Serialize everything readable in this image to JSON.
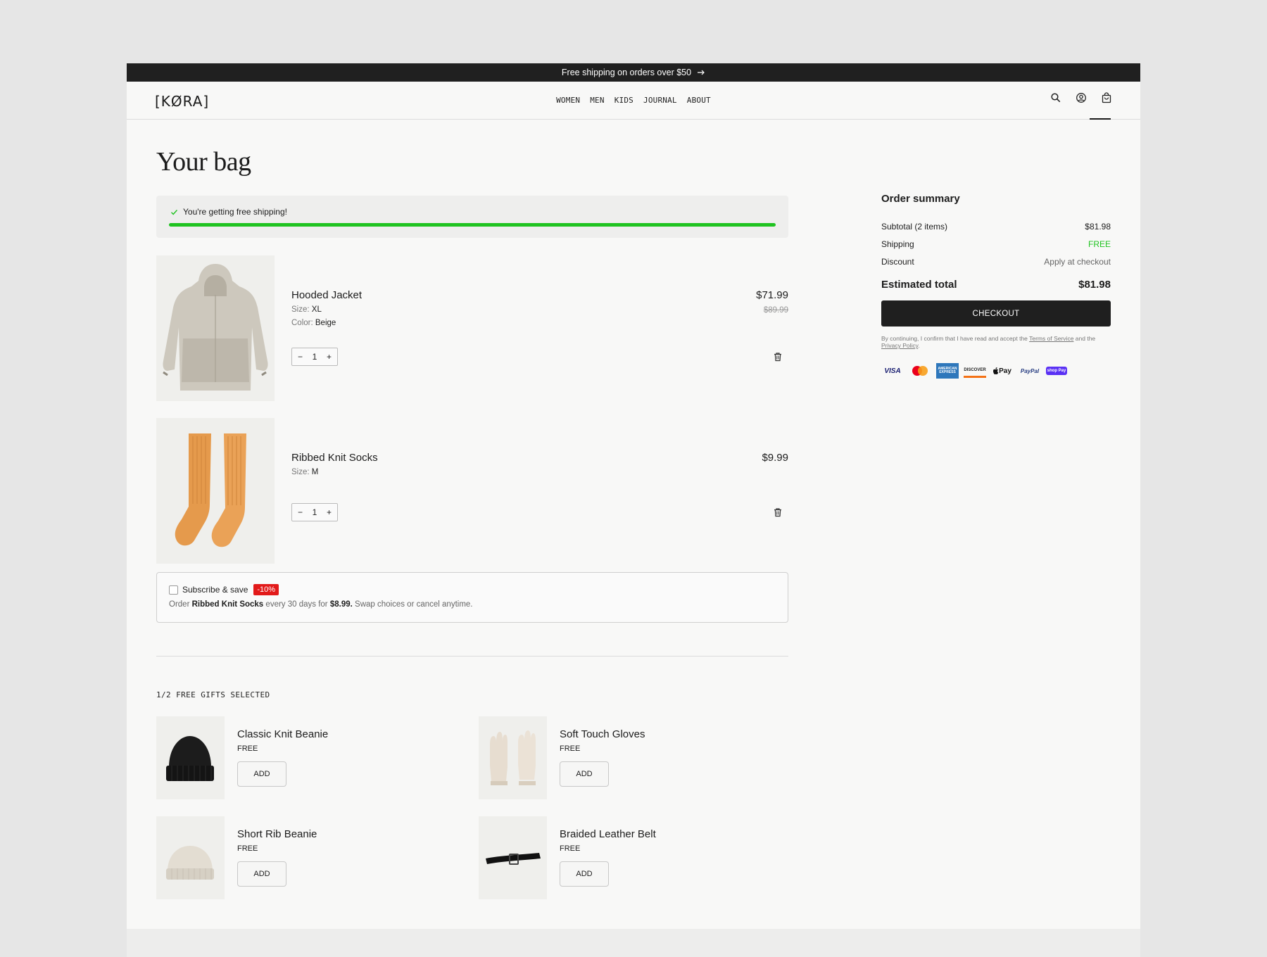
{
  "announcement": {
    "text": "Free shipping on orders over $50"
  },
  "header": {
    "logo": "[KØRA]",
    "nav": [
      "WOMEN",
      "MEN",
      "KIDS",
      "JOURNAL",
      "ABOUT"
    ]
  },
  "page": {
    "title": "Your bag"
  },
  "shipping": {
    "message": "You're getting free shipping!",
    "progress_percent": 100,
    "accent": "#1fc320"
  },
  "items": [
    {
      "name": "Hooded Jacket",
      "size_label": "Size:",
      "size": "XL",
      "color_label": "Color:",
      "color": "Beige",
      "price": "$71.99",
      "old_price": "$89.99",
      "qty": "1"
    },
    {
      "name": "Ribbed Knit Socks",
      "size_label": "Size:",
      "size": "M",
      "price": "$9.99",
      "qty": "1"
    }
  ],
  "subscribe": {
    "label": "Subscribe & save",
    "badge": "-10%",
    "line_prefix": "Order",
    "product": "Ribbed Knit Socks",
    "line_mid": "every 30 days for",
    "sub_price": "$8.99.",
    "line_suffix": "Swap choices or cancel anytime."
  },
  "gifts": {
    "title": "1/2 FREE GIFTS SELECTED",
    "items": [
      {
        "name": "Classic Knit Beanie",
        "price": "FREE",
        "button": "ADD"
      },
      {
        "name": "Soft Touch Gloves",
        "price": "FREE",
        "button": "ADD"
      },
      {
        "name": "Short Rib Beanie",
        "price": "FREE",
        "button": "ADD"
      },
      {
        "name": "Braided Leather Belt",
        "price": "FREE",
        "button": "ADD"
      }
    ]
  },
  "summary": {
    "title": "Order summary",
    "subtotal_label": "Subtotal (2 items)",
    "subtotal": "$81.98",
    "shipping_label": "Shipping",
    "shipping": "FREE",
    "discount_label": "Discount",
    "discount": "Apply at checkout",
    "total_label": "Estimated total",
    "total": "$81.98",
    "checkout": "CHECKOUT",
    "legal_prefix": "By continuing, I confirm that I have read and accept the",
    "terms": "Terms of Service",
    "legal_and": "and the",
    "privacy": "Privacy Policy",
    "legal_end": "."
  },
  "payments": [
    "VISA",
    "Mastercard",
    "AMERICAN EXPRESS",
    "DISCOVER",
    "Pay",
    "PayPal",
    "shop Pay"
  ]
}
